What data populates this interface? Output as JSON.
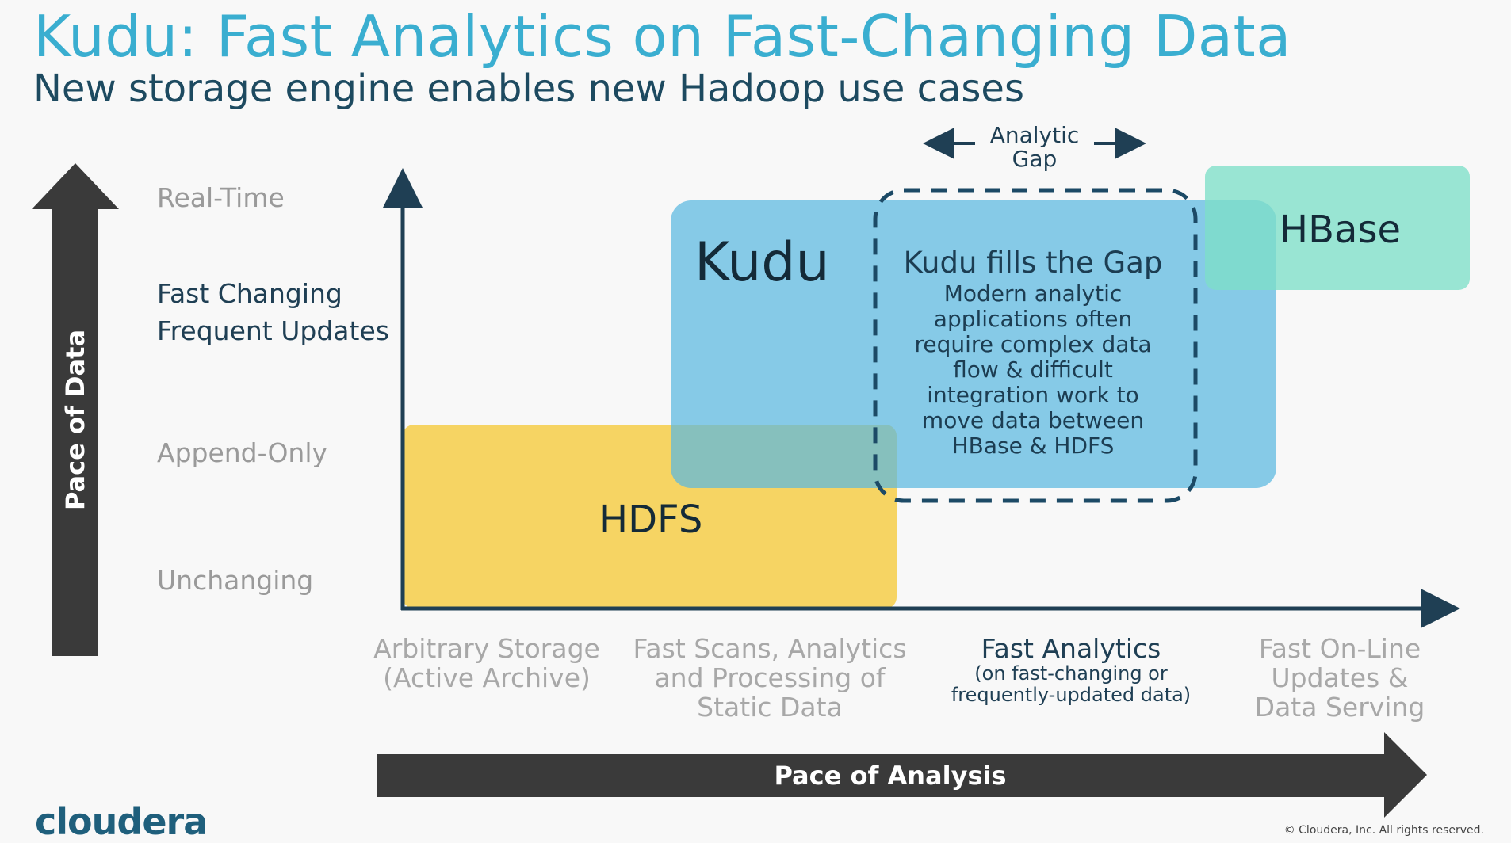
{
  "title": "Kudu: Fast Analytics on Fast-Changing Data",
  "subtitle": "New storage engine enables new Hadoop use cases",
  "y_axis": {
    "label": "Pace of Data",
    "levels": [
      {
        "label": "Real-Time"
      },
      {
        "label": "Fast Changing\nFrequent Updates"
      },
      {
        "label": "Append-Only"
      },
      {
        "label": "Unchanging"
      }
    ]
  },
  "x_axis": {
    "label": "Pace of Analysis",
    "categories": [
      {
        "label": "Arbitrary Storage\n(Active Archive)",
        "sub": ""
      },
      {
        "label": "Fast Scans, Analytics\nand Processing of\nStatic Data",
        "sub": ""
      },
      {
        "label": "Fast Analytics",
        "sub": "(on fast-changing  or\nfrequently-updated data)"
      },
      {
        "label": "Fast On-Line\nUpdates &\nData Serving",
        "sub": ""
      }
    ]
  },
  "boxes": {
    "hdfs": {
      "label": "HDFS",
      "color": "#f5d056"
    },
    "kudu": {
      "label": "Kudu",
      "color": "#5ab9e0"
    },
    "hbase": {
      "label": "HBase",
      "color": "#7ddfc8"
    }
  },
  "gap": {
    "label": "Analytic\nGap",
    "title": "Kudu fills the Gap",
    "body": "Modern analytic\napplications often\nrequire complex data\nflow & difficult\nintegration work to\nmove data between\nHBase & HDFS"
  },
  "logo": "cloudera",
  "copyright": "© Cloudera, Inc. All rights reserved.",
  "colors": {
    "title": "#3aaed0",
    "subtitle": "#1d4a60",
    "arrow": "#3a3a3a",
    "axis": "#1f3f54"
  }
}
